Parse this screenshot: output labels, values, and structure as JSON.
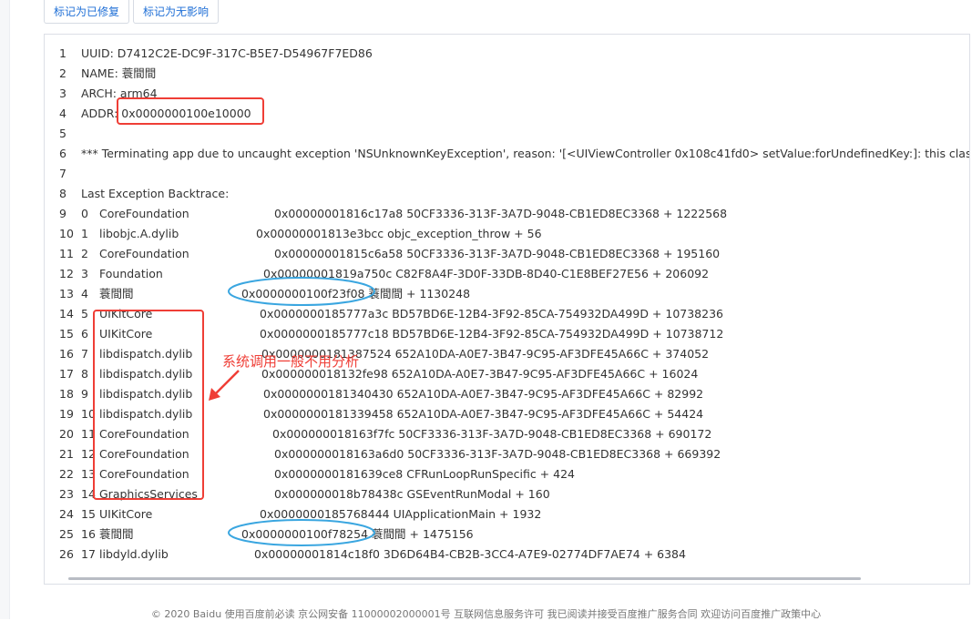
{
  "toolbar": {
    "mark_fixed_label": "标记为已修复",
    "mark_no_effect_label": "标记为无影响"
  },
  "log": {
    "header_lines": [
      {
        "n": "1",
        "text": "UUID: D7412C2E-DC9F-317C-B5E7-D54967F7ED86"
      },
      {
        "n": "2",
        "text": "NAME: 蓑間間"
      },
      {
        "n": "3",
        "text": "ARCH: arm64"
      },
      {
        "n": "4",
        "text": "ADDR: 0x0000000100e10000"
      },
      {
        "n": "5",
        "text": ""
      },
      {
        "n": "6",
        "text": "*** Terminating app due to uncaught exception 'NSUnknownKeyException', reason: '[<UIViewController 0x108c41fd0> setValue:forUndefinedKey:]: this class is not key value coding-compliant for the key"
      },
      {
        "n": "7",
        "text": ""
      },
      {
        "n": "8",
        "text": "Last Exception Backtrace:"
      }
    ],
    "frames": [
      {
        "n": "9",
        "idx": "0",
        "lib": "CoreFoundation",
        "addr": "0x00000001816c17a8 50CF3336-313F-3A7D-9048-CB1ED8EC3368 + 1222568"
      },
      {
        "n": "10",
        "idx": "1",
        "lib": "libobjc.A.dylib",
        "addr": "0x00000001813e3bcc objc_exception_throw + 56"
      },
      {
        "n": "11",
        "idx": "2",
        "lib": "CoreFoundation",
        "addr": "0x00000001815c6a58 50CF3336-313F-3A7D-9048-CB1ED8EC3368 + 195160"
      },
      {
        "n": "12",
        "idx": "3",
        "lib": "Foundation",
        "addr": "0x00000001819a750c C82F8A4F-3D0F-33DB-8D40-C1E8BEF27E56 + 206092"
      },
      {
        "n": "13",
        "idx": "4",
        "lib": "蓑間間",
        "addr": "0x0000000100f23f08 蓑間間 + 1130248"
      },
      {
        "n": "14",
        "idx": "5",
        "lib": "UIKitCore",
        "addr": "0x0000000185777a3c BD57BD6E-12B4-3F92-85CA-754932DA499D + 10738236"
      },
      {
        "n": "15",
        "idx": "6",
        "lib": "UIKitCore",
        "addr": "0x0000000185777c18 BD57BD6E-12B4-3F92-85CA-754932DA499D + 10738712"
      },
      {
        "n": "16",
        "idx": "7",
        "lib": "libdispatch.dylib",
        "addr": "0x0000000181387524 652A10DA-A0E7-3B47-9C95-AF3DFE45A66C + 374052"
      },
      {
        "n": "17",
        "idx": "8",
        "lib": "libdispatch.dylib",
        "addr": "0x000000018132fe98 652A10DA-A0E7-3B47-9C95-AF3DFE45A66C + 16024"
      },
      {
        "n": "18",
        "idx": "9",
        "lib": "libdispatch.dylib",
        "addr": "0x0000000181340430 652A10DA-A0E7-3B47-9C95-AF3DFE45A66C + 82992"
      },
      {
        "n": "19",
        "idx": "10",
        "lib": "libdispatch.dylib",
        "addr": "0x0000000181339458 652A10DA-A0E7-3B47-9C95-AF3DFE45A66C + 54424"
      },
      {
        "n": "20",
        "idx": "11",
        "lib": "CoreFoundation",
        "addr": "0x000000018163f7fc 50CF3336-313F-3A7D-9048-CB1ED8EC3368 + 690172"
      },
      {
        "n": "21",
        "idx": "12",
        "lib": "CoreFoundation",
        "addr": "0x000000018163a6d0 50CF3336-313F-3A7D-9048-CB1ED8EC3368 + 669392"
      },
      {
        "n": "22",
        "idx": "13",
        "lib": "CoreFoundation",
        "addr": "0x0000000181639ce8 CFRunLoopRunSpecific + 424"
      },
      {
        "n": "23",
        "idx": "14",
        "lib": "GraphicsServices",
        "addr": "0x000000018b78438c GSEventRunModal + 160"
      },
      {
        "n": "24",
        "idx": "15",
        "lib": "UIKitCore",
        "addr": "0x0000000185768444 UIApplicationMain + 1932"
      },
      {
        "n": "25",
        "idx": "16",
        "lib": "蓑間間",
        "addr": "0x0000000100f78254 蓑間間 + 1475156"
      },
      {
        "n": "26",
        "idx": "17",
        "lib": "libdyld.dylib",
        "addr": "0x00000001814c18f0 3D6D64B4-CB2B-3CC4-A7E9-02774DF7AE74 + 6384"
      }
    ]
  },
  "annotation": {
    "text": "系统调用一般不用分析",
    "color": "#ef3e36",
    "ellipse_color": "#3aa6e0"
  },
  "footer": {
    "text": "© 2020 Baidu  使用百度前必读  京公网安备 11000002000001号  互联网信息服务许可  我已阅读并接受百度推广服务合同  欢迎访问百度推广政策中心"
  }
}
